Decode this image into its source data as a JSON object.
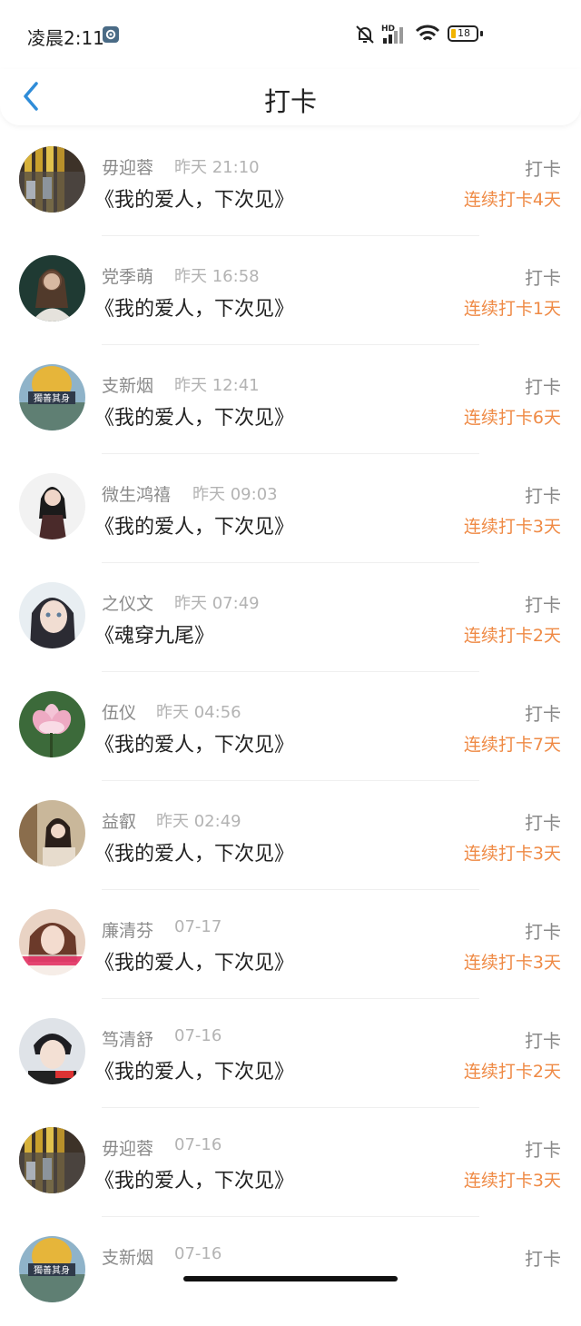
{
  "status_bar": {
    "time": "凌晨2:11",
    "network_label": "HD",
    "battery_level": "18",
    "icons": [
      "settings-icon",
      "mute-bell-icon",
      "signal-icon",
      "wifi-icon",
      "battery-icon"
    ]
  },
  "nav": {
    "back_icon": "chevron-left-icon",
    "title": "打卡"
  },
  "colors": {
    "accent_blue": "#2f8cd8",
    "streak_orange": "#ef8a45",
    "name_gray": "#8a8a8a",
    "time_gray": "#b3b3b3"
  },
  "rows": [
    {
      "name": "毋迎蓉",
      "time": "昨天 21:10",
      "book": "《我的爱人，下次见》",
      "action": "打卡",
      "streak": "连续打卡4天"
    },
    {
      "name": "党季萌",
      "time": "昨天 16:58",
      "book": "《我的爱人，下次见》",
      "action": "打卡",
      "streak": "连续打卡1天"
    },
    {
      "name": "支新烟",
      "time": "昨天 12:41",
      "book": "《我的爱人，下次见》",
      "action": "打卡",
      "streak": "连续打卡6天"
    },
    {
      "name": "微生鸿禧",
      "time": "昨天 09:03",
      "book": "《我的爱人，下次见》",
      "action": "打卡",
      "streak": "连续打卡3天"
    },
    {
      "name": "之仪文",
      "time": "昨天 07:49",
      "book": "《魂穿九尾》",
      "action": "打卡",
      "streak": "连续打卡2天"
    },
    {
      "name": "伍仪",
      "time": "昨天 04:56",
      "book": "《我的爱人，下次见》",
      "action": "打卡",
      "streak": "连续打卡7天"
    },
    {
      "name": "益叡",
      "time": "昨天 02:49",
      "book": "《我的爱人，下次见》",
      "action": "打卡",
      "streak": "连续打卡3天"
    },
    {
      "name": "廉清芬",
      "time": "07-17",
      "book": "《我的爱人，下次见》",
      "action": "打卡",
      "streak": "连续打卡3天"
    },
    {
      "name": "笃清舒",
      "time": "07-16",
      "book": "《我的爱人，下次见》",
      "action": "打卡",
      "streak": "连续打卡2天"
    },
    {
      "name": "毋迎蓉",
      "time": "07-16",
      "book": "《我的爱人，下次见》",
      "action": "打卡",
      "streak": "连续打卡3天"
    },
    {
      "name": "支新烟",
      "time": "07-16",
      "book": "",
      "action": "打卡",
      "streak": ""
    }
  ]
}
